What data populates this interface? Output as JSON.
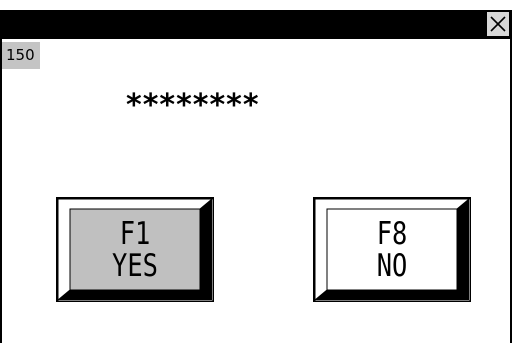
{
  "window": {
    "close_glyph": "✕"
  },
  "screen_number": "150",
  "password_mask": "********",
  "buttons": {
    "yes": {
      "key": "F1",
      "label": "YES",
      "face_color": "#c0c0c0"
    },
    "no": {
      "key": "F8",
      "label": "NO",
      "face_color": "#ffffff"
    }
  }
}
